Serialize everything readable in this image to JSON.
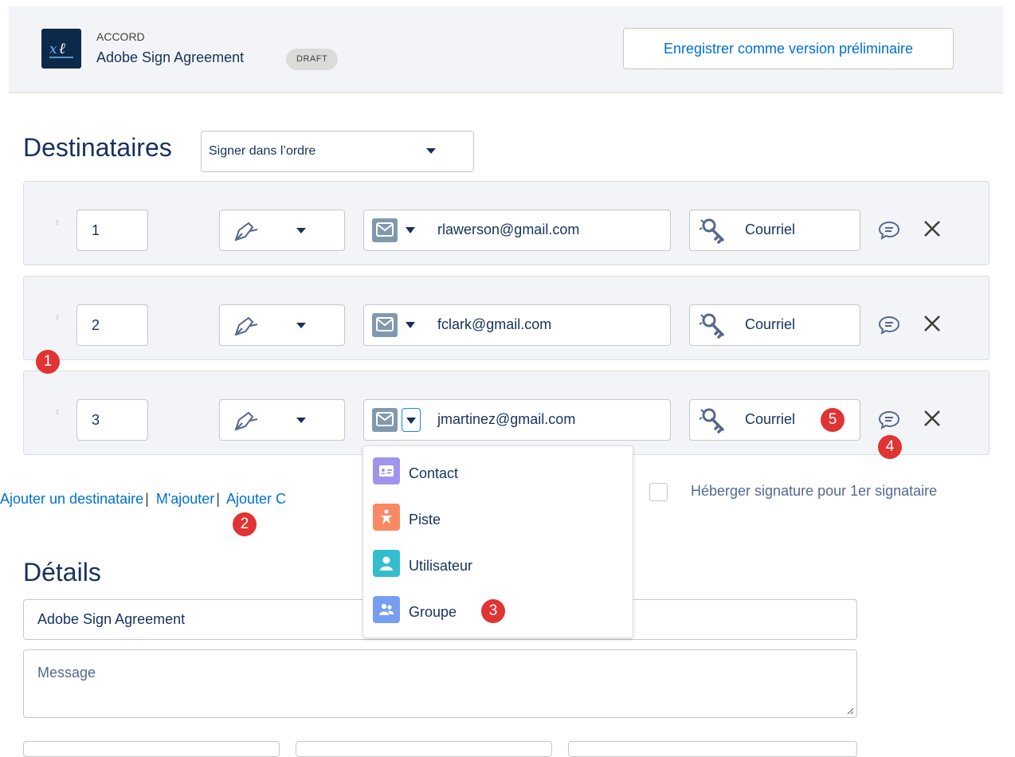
{
  "header": {
    "object_label": "ACCORD",
    "agreement_name": "Adobe Sign Agreement",
    "status_badge": "DRAFT",
    "save_draft_label": "Enregistrer comme version préliminaire"
  },
  "recipients": {
    "title": "Destinataires",
    "order_select": "Signer dans l’ordre",
    "rows": [
      {
        "order": "1",
        "email": "rlawerson@gmail.com",
        "auth": "Courriel"
      },
      {
        "order": "2",
        "email": "fclark@gmail.com",
        "auth": "Courriel"
      },
      {
        "order": "3",
        "email": "jmartinez@gmail.com",
        "auth": "Courriel"
      }
    ]
  },
  "recipient_type_menu": {
    "items": [
      {
        "label": "Contact",
        "icon": "contact-card-icon",
        "color": "#a094ed"
      },
      {
        "label": "Piste",
        "icon": "lead-person-icon",
        "color": "#f88962"
      },
      {
        "label": "Utilisateur",
        "icon": "user-icon",
        "color": "#34becd"
      },
      {
        "label": "Groupe",
        "icon": "group-icon",
        "color": "#779ef2"
      }
    ]
  },
  "links": {
    "add_recipient": "Ajouter un destinataire",
    "add_me": "M'ajouter",
    "add_other": "Ajouter C",
    "separator": "|"
  },
  "host_signature_label": "Héberger signature pour 1er signataire",
  "details": {
    "title": "Détails",
    "agreement_name_value": "Adobe Sign Agreement",
    "message_placeholder": "Message"
  },
  "callouts": [
    "1",
    "2",
    "3",
    "4",
    "5"
  ],
  "colors": {
    "accent": "#0070d2",
    "callout": "#e03333",
    "panel": "#f3f4f7"
  }
}
